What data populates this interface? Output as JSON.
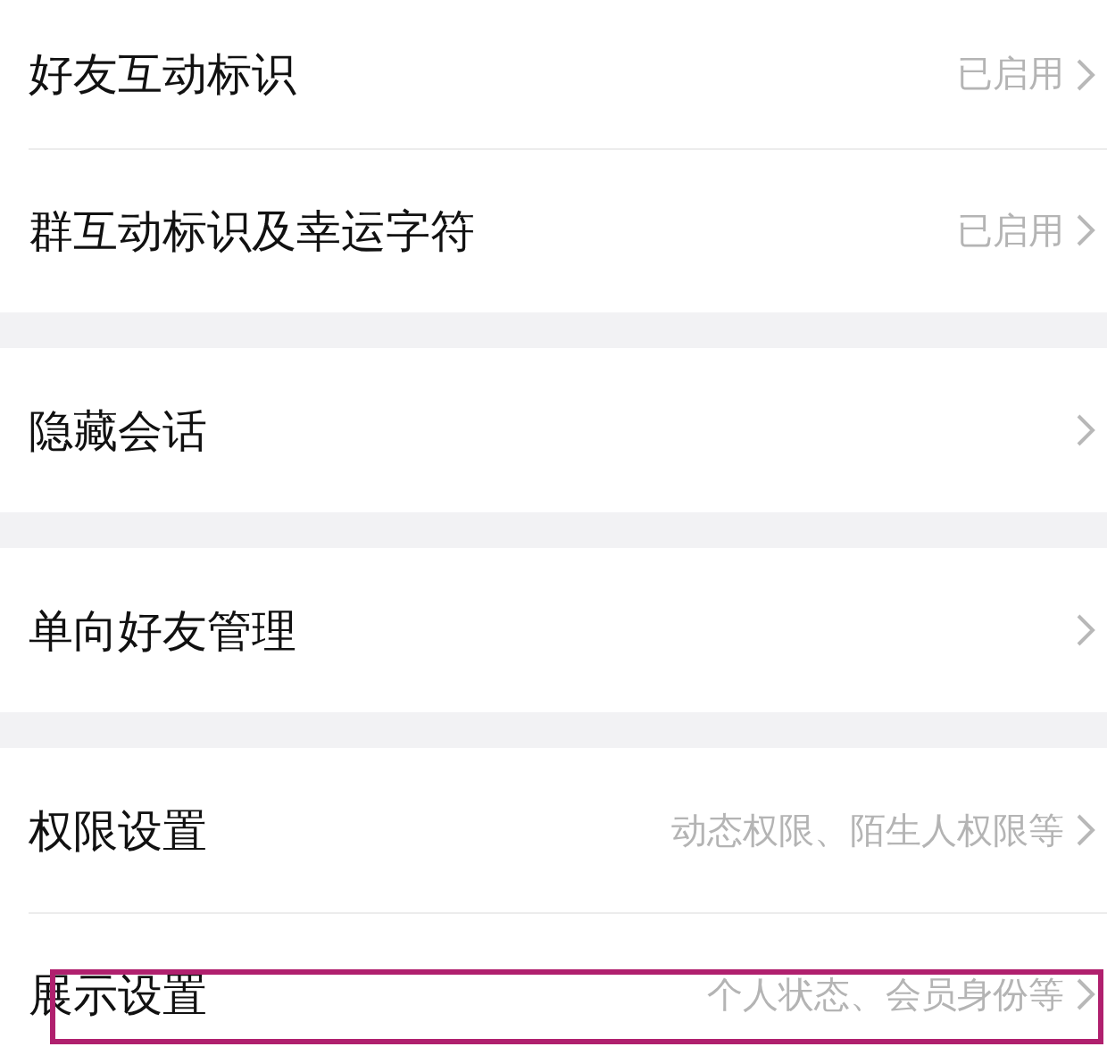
{
  "groups": [
    {
      "items": [
        {
          "label": "好友互动标识",
          "value": "已启用",
          "highlighted": false
        },
        {
          "label": "群互动标识及幸运字符",
          "value": "已启用",
          "highlighted": false
        }
      ]
    },
    {
      "items": [
        {
          "label": "隐藏会话",
          "highlighted": false
        }
      ]
    },
    {
      "items": [
        {
          "label": "单向好友管理",
          "highlighted": false
        }
      ]
    },
    {
      "items": [
        {
          "label": "权限设置",
          "value": "动态权限、陌生人权限等",
          "highlighted": false
        },
        {
          "label": "展示设置",
          "value": "个人状态、会员身份等",
          "highlighted": true
        }
      ]
    }
  ]
}
